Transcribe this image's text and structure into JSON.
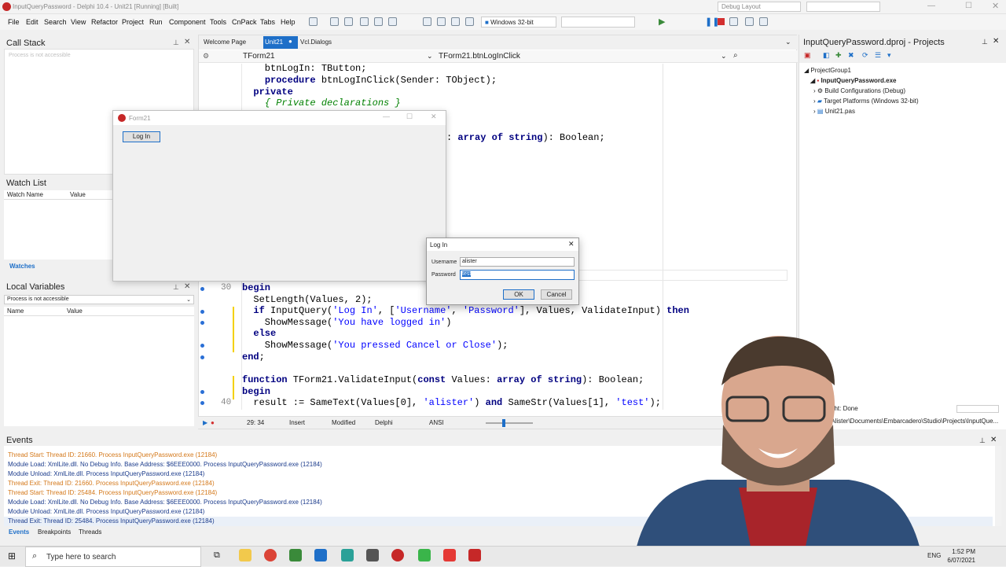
{
  "window": {
    "title": "InputQueryPassword - Delphi 10.4 - Unit21 [Running] [Built]",
    "layout": "Debug Layout"
  },
  "menu": [
    "File",
    "Edit",
    "Search",
    "View",
    "Refactor",
    "Project",
    "Run",
    "Component",
    "Tools",
    "CnPack",
    "Tabs",
    "Help"
  ],
  "toolbar": {
    "platform": "Windows 32-bit"
  },
  "call_stack": {
    "title": "Call Stack",
    "status": "Process is not accessible"
  },
  "watch_list": {
    "title": "Watch List",
    "col_name": "Watch Name",
    "col_value": "Value",
    "tab": "Watches"
  },
  "local_vars": {
    "title": "Local Variables",
    "dropdown": "Process is not accessible",
    "col_name": "Name",
    "col_value": "Value"
  },
  "editor": {
    "tabs": [
      "Welcome Page",
      "Unit21",
      "Vcl.Dialogs"
    ],
    "class_combo": "TForm21",
    "method_combo": "TForm21.btnLogInClick",
    "lines": [
      {
        "num": "",
        "text": "    btnLogIn: TButton;"
      },
      {
        "num": "",
        "text": "    procedure btnLogInClick(Sender: TObject);"
      },
      {
        "num": "",
        "text": "  private"
      },
      {
        "num": "",
        "text": "    { Private declarations }"
      },
      {
        "num": "",
        "text": "): array of string): Boolean;"
      },
      {
        "num": "30",
        "text": "begin"
      },
      {
        "num": "",
        "text": "  SetLength(Values, 2);"
      },
      {
        "num": "",
        "text": "  if InputQuery('Log In', ['Username', 'Password'], Values, ValidateInput) then"
      },
      {
        "num": "",
        "text": "    ShowMessage('You have logged in')"
      },
      {
        "num": "",
        "text": "  else"
      },
      {
        "num": "",
        "text": "    ShowMessage('You pressed Cancel or Close');"
      },
      {
        "num": "",
        "text": "end;"
      },
      {
        "num": "",
        "text": "function TForm21.ValidateInput(const Values: array of string): Boolean;"
      },
      {
        "num": "",
        "text": "begin"
      },
      {
        "num": "40",
        "text": "  result := SameText(Values[0], 'alister') and SameStr(Values[1], 'test');"
      }
    ],
    "status": {
      "position": "29: 34",
      "mode": "Insert",
      "modified": "Modified",
      "language": "Delphi",
      "encoding": "ANSI"
    }
  },
  "form21": {
    "title": "Form21",
    "button": "Log In"
  },
  "login_dialog": {
    "title": "Log In",
    "username_label": "Username",
    "username_value": "alister",
    "password_label": "Password",
    "password_value": "test",
    "ok": "OK",
    "cancel": "Cancel"
  },
  "projects": {
    "title": "InputQueryPassword.dproj - Projects",
    "tree": [
      "ProjectGroup1",
      "InputQueryPassword.exe",
      "Build Configurations (Debug)",
      "Target Platforms (Windows 32-bit)",
      "Unit21.pas"
    ]
  },
  "messages": {
    "status_text": "ght: Done",
    "path_text": "\\Alister\\Documents\\Embarcadero\\Studio\\Projects\\InputQue..."
  },
  "events": {
    "title": "Events",
    "lines": [
      {
        "text": "Thread Start: Thread ID: 21660. Process InputQueryPassword.exe (12184)",
        "color": "orange"
      },
      {
        "text": "Module Load: XmlLite.dll. No Debug Info. Base Address: $6EEE0000. Process InputQueryPassword.exe (12184)",
        "color": "blue"
      },
      {
        "text": "Module Unload: XmlLite.dll. Process InputQueryPassword.exe (12184)",
        "color": "blue"
      },
      {
        "text": "Thread Exit: Thread ID: 21660. Process InputQueryPassword.exe (12184)",
        "color": "orange"
      },
      {
        "text": "Thread Start: Thread ID: 25484. Process InputQueryPassword.exe (12184)",
        "color": "orange"
      },
      {
        "text": "Module Load: XmlLite.dll. No Debug Info. Base Address: $6EEE0000. Process InputQueryPassword.exe (12184)",
        "color": "blue"
      },
      {
        "text": "Module Unload: XmlLite.dll. Process InputQueryPassword.exe (12184)",
        "color": "blue"
      },
      {
        "text": "Thread Exit: Thread ID: 25484. Process InputQueryPassword.exe (12184)",
        "color": "blue"
      }
    ],
    "tabs": [
      "Events",
      "Breakpoints",
      "Threads"
    ]
  },
  "taskbar": {
    "search": "Type here to search",
    "lang": "ENG",
    "time": "1:52 PM",
    "date": "6/07/2021"
  },
  "colors": {
    "accent": "#1e6fc8",
    "keyword": "#000080",
    "string": "#0000ff",
    "comment": "#008000"
  }
}
